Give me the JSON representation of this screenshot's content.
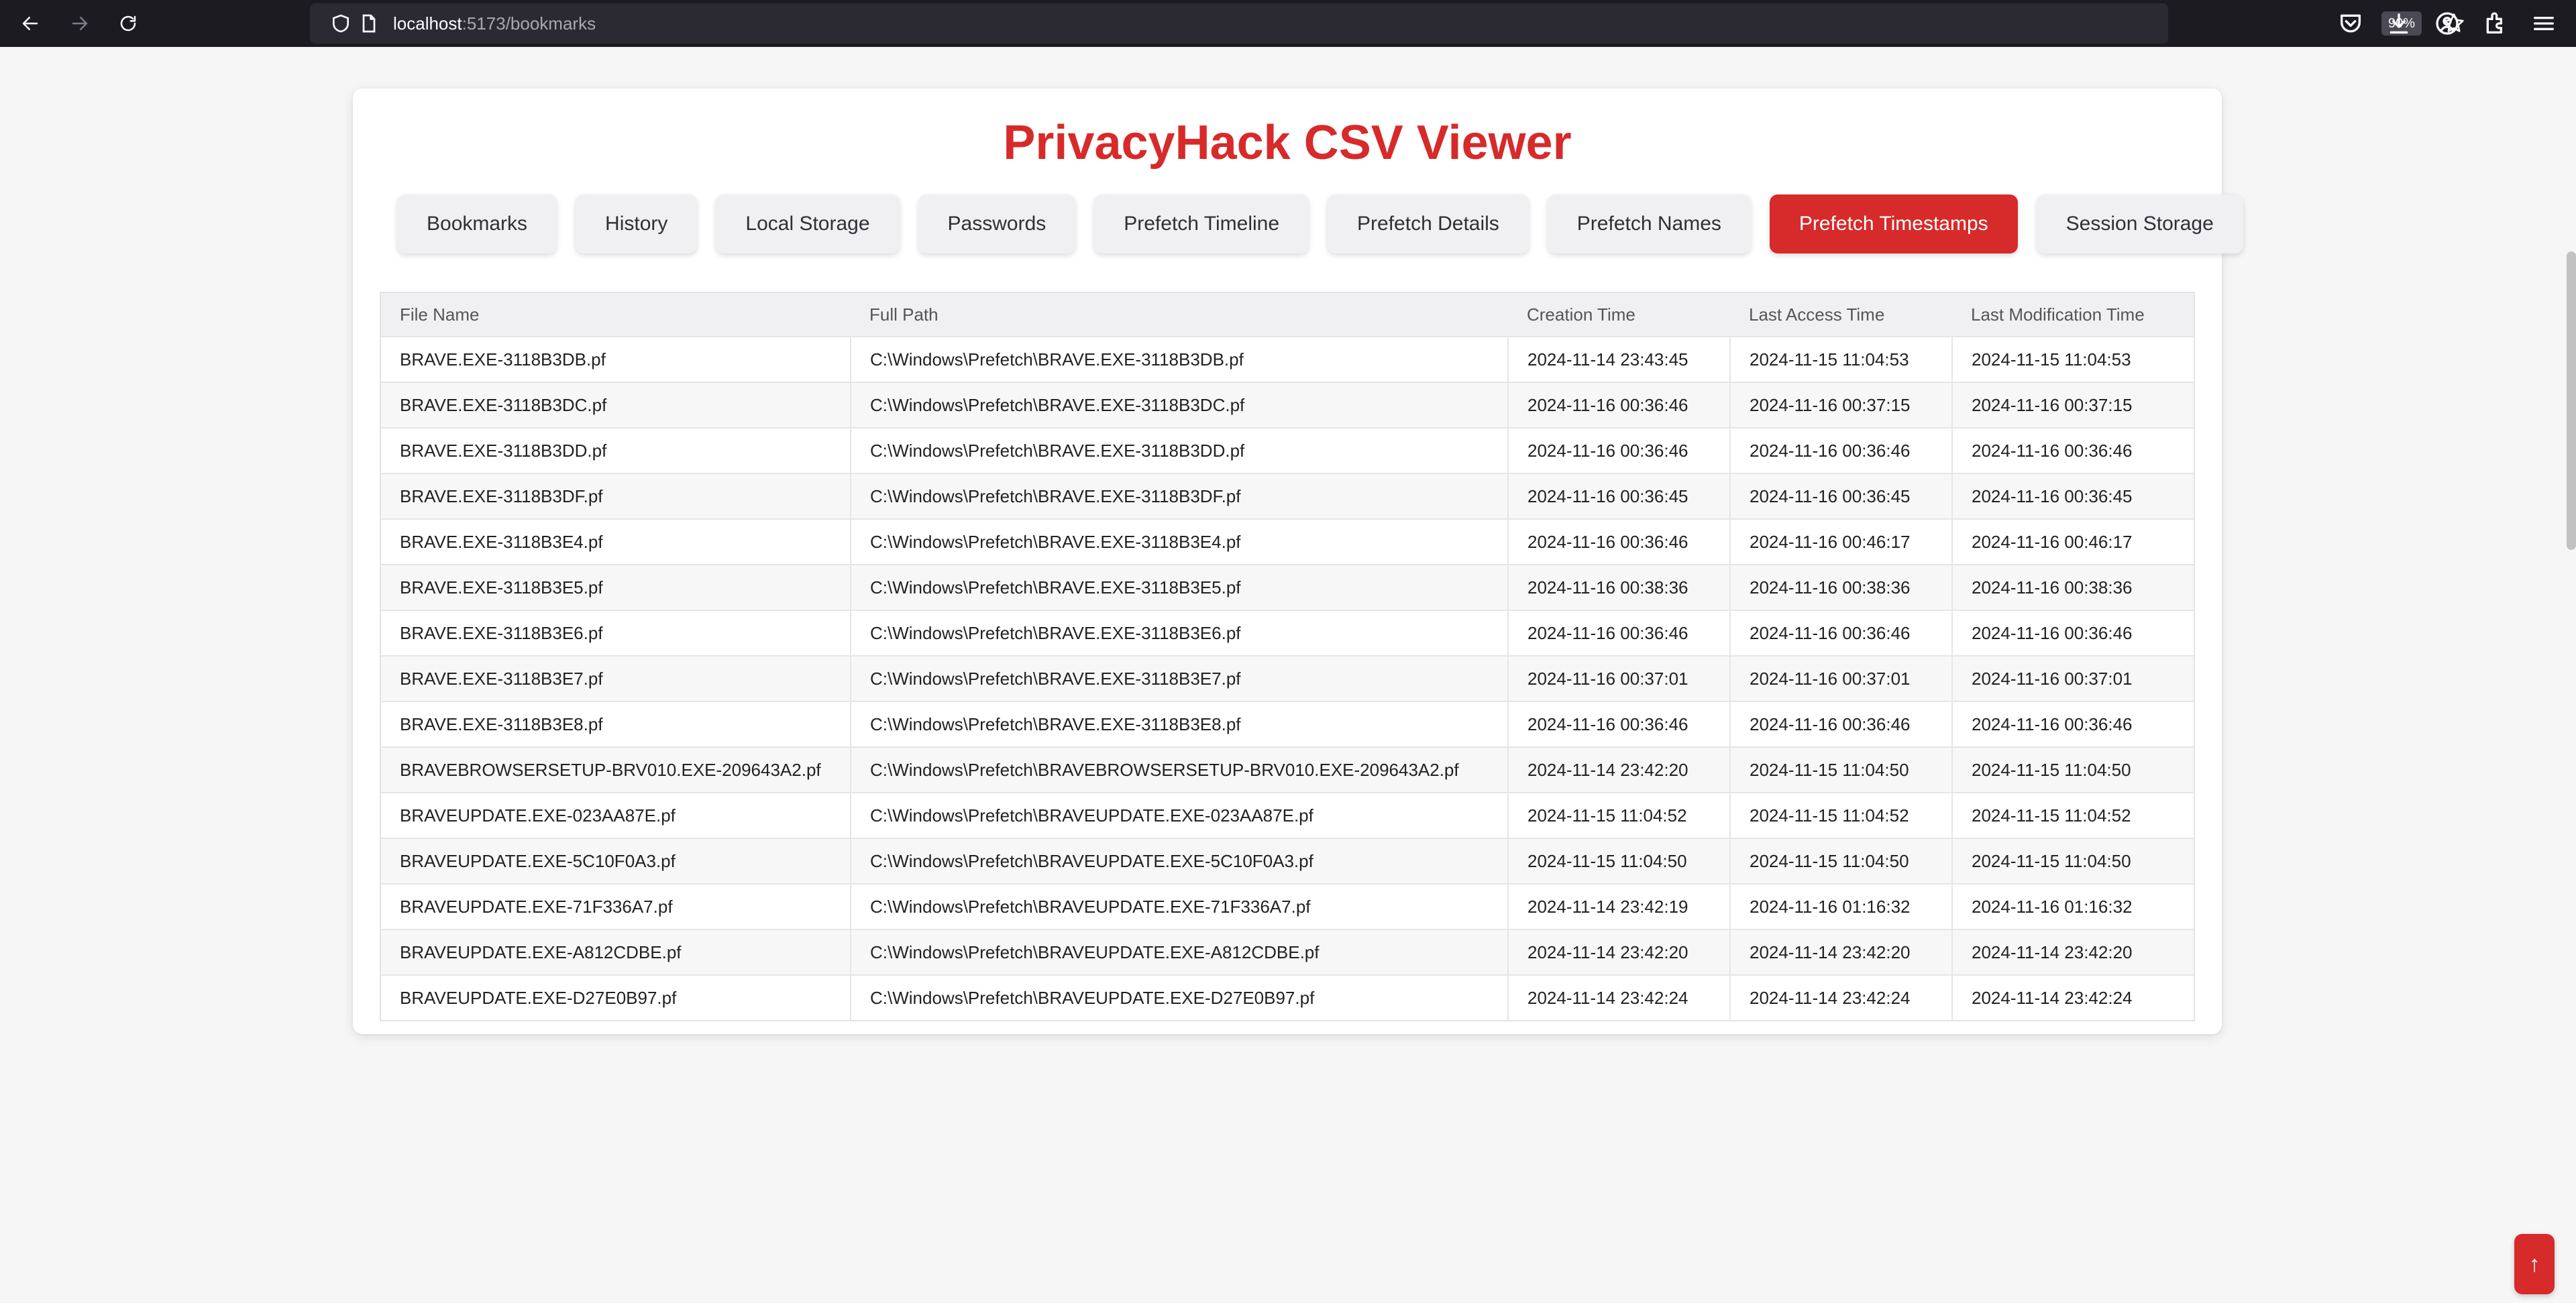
{
  "browser": {
    "url_host": "localhost",
    "url_path": ":5173/bookmarks",
    "zoom": "90%"
  },
  "app": {
    "title": "PrivacyHack CSV Viewer",
    "accent_color": "#d72a2a"
  },
  "tabs": [
    {
      "label": "Bookmarks",
      "active": false
    },
    {
      "label": "History",
      "active": false
    },
    {
      "label": "Local Storage",
      "active": false
    },
    {
      "label": "Passwords",
      "active": false
    },
    {
      "label": "Prefetch Timeline",
      "active": false
    },
    {
      "label": "Prefetch Details",
      "active": false
    },
    {
      "label": "Prefetch Names",
      "active": false
    },
    {
      "label": "Prefetch Timestamps",
      "active": true
    },
    {
      "label": "Session Storage",
      "active": false
    }
  ],
  "table": {
    "columns": [
      "File Name",
      "Full Path",
      "Creation Time",
      "Last Access Time",
      "Last Modification Time"
    ],
    "rows": [
      [
        "BRAVE.EXE-3118B3DB.pf",
        "C:\\Windows\\Prefetch\\BRAVE.EXE-3118B3DB.pf",
        "2024-11-14 23:43:45",
        "2024-11-15 11:04:53",
        "2024-11-15 11:04:53"
      ],
      [
        "BRAVE.EXE-3118B3DC.pf",
        "C:\\Windows\\Prefetch\\BRAVE.EXE-3118B3DC.pf",
        "2024-11-16 00:36:46",
        "2024-11-16 00:37:15",
        "2024-11-16 00:37:15"
      ],
      [
        "BRAVE.EXE-3118B3DD.pf",
        "C:\\Windows\\Prefetch\\BRAVE.EXE-3118B3DD.pf",
        "2024-11-16 00:36:46",
        "2024-11-16 00:36:46",
        "2024-11-16 00:36:46"
      ],
      [
        "BRAVE.EXE-3118B3DF.pf",
        "C:\\Windows\\Prefetch\\BRAVE.EXE-3118B3DF.pf",
        "2024-11-16 00:36:45",
        "2024-11-16 00:36:45",
        "2024-11-16 00:36:45"
      ],
      [
        "BRAVE.EXE-3118B3E4.pf",
        "C:\\Windows\\Prefetch\\BRAVE.EXE-3118B3E4.pf",
        "2024-11-16 00:36:46",
        "2024-11-16 00:46:17",
        "2024-11-16 00:46:17"
      ],
      [
        "BRAVE.EXE-3118B3E5.pf",
        "C:\\Windows\\Prefetch\\BRAVE.EXE-3118B3E5.pf",
        "2024-11-16 00:38:36",
        "2024-11-16 00:38:36",
        "2024-11-16 00:38:36"
      ],
      [
        "BRAVE.EXE-3118B3E6.pf",
        "C:\\Windows\\Prefetch\\BRAVE.EXE-3118B3E6.pf",
        "2024-11-16 00:36:46",
        "2024-11-16 00:36:46",
        "2024-11-16 00:36:46"
      ],
      [
        "BRAVE.EXE-3118B3E7.pf",
        "C:\\Windows\\Prefetch\\BRAVE.EXE-3118B3E7.pf",
        "2024-11-16 00:37:01",
        "2024-11-16 00:37:01",
        "2024-11-16 00:37:01"
      ],
      [
        "BRAVE.EXE-3118B3E8.pf",
        "C:\\Windows\\Prefetch\\BRAVE.EXE-3118B3E8.pf",
        "2024-11-16 00:36:46",
        "2024-11-16 00:36:46",
        "2024-11-16 00:36:46"
      ],
      [
        "BRAVEBROWSERSETUP-BRV010.EXE-209643A2.pf",
        "C:\\Windows\\Prefetch\\BRAVEBROWSERSETUP-BRV010.EXE-209643A2.pf",
        "2024-11-14 23:42:20",
        "2024-11-15 11:04:50",
        "2024-11-15 11:04:50"
      ],
      [
        "BRAVEUPDATE.EXE-023AA87E.pf",
        "C:\\Windows\\Prefetch\\BRAVEUPDATE.EXE-023AA87E.pf",
        "2024-11-15 11:04:52",
        "2024-11-15 11:04:52",
        "2024-11-15 11:04:52"
      ],
      [
        "BRAVEUPDATE.EXE-5C10F0A3.pf",
        "C:\\Windows\\Prefetch\\BRAVEUPDATE.EXE-5C10F0A3.pf",
        "2024-11-15 11:04:50",
        "2024-11-15 11:04:50",
        "2024-11-15 11:04:50"
      ],
      [
        "BRAVEUPDATE.EXE-71F336A7.pf",
        "C:\\Windows\\Prefetch\\BRAVEUPDATE.EXE-71F336A7.pf",
        "2024-11-14 23:42:19",
        "2024-11-16 01:16:32",
        "2024-11-16 01:16:32"
      ],
      [
        "BRAVEUPDATE.EXE-A812CDBE.pf",
        "C:\\Windows\\Prefetch\\BRAVEUPDATE.EXE-A812CDBE.pf",
        "2024-11-14 23:42:20",
        "2024-11-14 23:42:20",
        "2024-11-14 23:42:20"
      ],
      [
        "BRAVEUPDATE.EXE-D27E0B97.pf",
        "C:\\Windows\\Prefetch\\BRAVEUPDATE.EXE-D27E0B97.pf",
        "2024-11-14 23:42:24",
        "2024-11-14 23:42:24",
        "2024-11-14 23:42:24"
      ]
    ]
  },
  "scroll_top_button": {
    "label": "↑"
  },
  "icons": {
    "back": "back-arrow-icon",
    "forward": "forward-arrow-icon",
    "reload": "reload-icon",
    "shield": "shield-icon",
    "page": "page-icon",
    "star": "star-icon",
    "pocket": "pocket-icon",
    "download": "download-icon",
    "account": "account-icon",
    "extensions": "extensions-icon",
    "menu": "menu-icon"
  }
}
